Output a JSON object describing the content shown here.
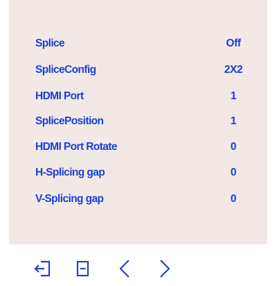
{
  "menu": {
    "items": [
      {
        "label": "Splice",
        "value": "Off"
      },
      {
        "label": "SpliceConfig",
        "value": "2X2"
      },
      {
        "label": "HDMI Port",
        "value": "1"
      },
      {
        "label": "SplicePosition",
        "value": "1"
      },
      {
        "label": "HDMI Port Rotate",
        "value": "0"
      },
      {
        "label": "H-Splicing gap",
        "value": "0"
      },
      {
        "label": "V-Splicing gap",
        "value": "0"
      }
    ]
  },
  "nav": {
    "icons": [
      "exit-icon",
      "menu-icon",
      "chevron-left-icon",
      "chevron-right-icon"
    ]
  },
  "colors": {
    "panel_bg": "#f2e9e7",
    "text": "#1a3fd6",
    "icon": "#2a3ed0"
  }
}
